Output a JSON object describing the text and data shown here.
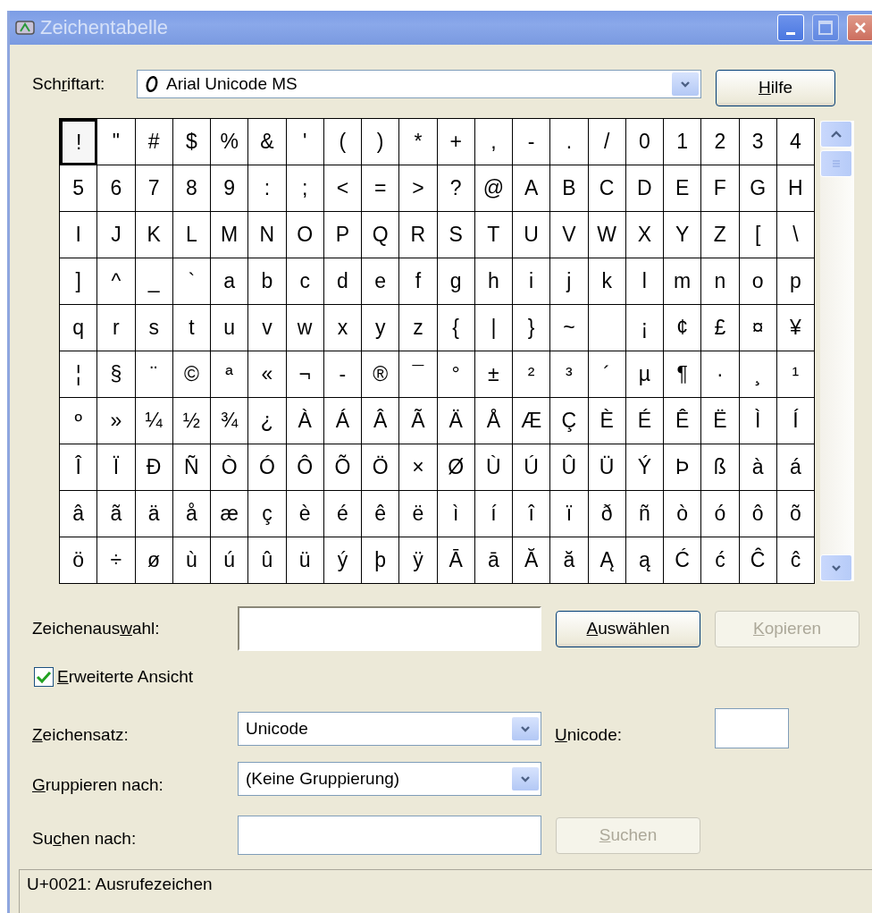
{
  "window": {
    "title": "Zeichentabelle",
    "active": false
  },
  "font": {
    "label": {
      "before": "Sch",
      "key": "r",
      "after": "iftart:"
    },
    "value": "Arial Unicode MS"
  },
  "help_button": {
    "label": {
      "key": "H",
      "after": "ilfe"
    }
  },
  "grid": {
    "rows": [
      {
        "cells": [
          {
            "char": "!",
            "selected": true
          },
          {
            "char": "\"",
            "selected": false
          },
          {
            "char": "#",
            "selected": false
          },
          {
            "char": "$",
            "selected": false
          },
          {
            "char": "%",
            "selected": false
          },
          {
            "char": "&",
            "selected": false
          },
          {
            "char": "'",
            "selected": false
          },
          {
            "char": "(",
            "selected": false
          },
          {
            "char": ")",
            "selected": false
          },
          {
            "char": "*",
            "selected": false
          },
          {
            "char": "+",
            "selected": false
          },
          {
            "char": ",",
            "selected": false
          },
          {
            "char": "-",
            "selected": false
          },
          {
            "char": ".",
            "selected": false
          },
          {
            "char": "/",
            "selected": false
          },
          {
            "char": "0",
            "selected": false
          },
          {
            "char": "1",
            "selected": false
          },
          {
            "char": "2",
            "selected": false
          },
          {
            "char": "3",
            "selected": false
          },
          {
            "char": "4",
            "selected": false
          }
        ]
      },
      {
        "cells": [
          {
            "char": "5",
            "selected": false
          },
          {
            "char": "6",
            "selected": false
          },
          {
            "char": "7",
            "selected": false
          },
          {
            "char": "8",
            "selected": false
          },
          {
            "char": "9",
            "selected": false
          },
          {
            "char": ":",
            "selected": false
          },
          {
            "char": ";",
            "selected": false
          },
          {
            "char": "<",
            "selected": false
          },
          {
            "char": "=",
            "selected": false
          },
          {
            "char": ">",
            "selected": false
          },
          {
            "char": "?",
            "selected": false
          },
          {
            "char": "@",
            "selected": false
          },
          {
            "char": "A",
            "selected": false
          },
          {
            "char": "B",
            "selected": false
          },
          {
            "char": "C",
            "selected": false
          },
          {
            "char": "D",
            "selected": false
          },
          {
            "char": "E",
            "selected": false
          },
          {
            "char": "F",
            "selected": false
          },
          {
            "char": "G",
            "selected": false
          },
          {
            "char": "H",
            "selected": false
          }
        ]
      },
      {
        "cells": [
          {
            "char": "I",
            "selected": false
          },
          {
            "char": "J",
            "selected": false
          },
          {
            "char": "K",
            "selected": false
          },
          {
            "char": "L",
            "selected": false
          },
          {
            "char": "M",
            "selected": false
          },
          {
            "char": "N",
            "selected": false
          },
          {
            "char": "O",
            "selected": false
          },
          {
            "char": "P",
            "selected": false
          },
          {
            "char": "Q",
            "selected": false
          },
          {
            "char": "R",
            "selected": false
          },
          {
            "char": "S",
            "selected": false
          },
          {
            "char": "T",
            "selected": false
          },
          {
            "char": "U",
            "selected": false
          },
          {
            "char": "V",
            "selected": false
          },
          {
            "char": "W",
            "selected": false
          },
          {
            "char": "X",
            "selected": false
          },
          {
            "char": "Y",
            "selected": false
          },
          {
            "char": "Z",
            "selected": false
          },
          {
            "char": "[",
            "selected": false
          },
          {
            "char": "\\",
            "selected": false
          }
        ]
      },
      {
        "cells": [
          {
            "char": "]",
            "selected": false
          },
          {
            "char": "^",
            "selected": false
          },
          {
            "char": "_",
            "selected": false
          },
          {
            "char": "`",
            "selected": false
          },
          {
            "char": "a",
            "selected": false
          },
          {
            "char": "b",
            "selected": false
          },
          {
            "char": "c",
            "selected": false
          },
          {
            "char": "d",
            "selected": false
          },
          {
            "char": "e",
            "selected": false
          },
          {
            "char": "f",
            "selected": false
          },
          {
            "char": "g",
            "selected": false
          },
          {
            "char": "h",
            "selected": false
          },
          {
            "char": "i",
            "selected": false
          },
          {
            "char": "j",
            "selected": false
          },
          {
            "char": "k",
            "selected": false
          },
          {
            "char": "l",
            "selected": false
          },
          {
            "char": "m",
            "selected": false
          },
          {
            "char": "n",
            "selected": false
          },
          {
            "char": "o",
            "selected": false
          },
          {
            "char": "p",
            "selected": false
          }
        ]
      },
      {
        "cells": [
          {
            "char": "q",
            "selected": false
          },
          {
            "char": "r",
            "selected": false
          },
          {
            "char": "s",
            "selected": false
          },
          {
            "char": "t",
            "selected": false
          },
          {
            "char": "u",
            "selected": false
          },
          {
            "char": "v",
            "selected": false
          },
          {
            "char": "w",
            "selected": false
          },
          {
            "char": "x",
            "selected": false
          },
          {
            "char": "y",
            "selected": false
          },
          {
            "char": "z",
            "selected": false
          },
          {
            "char": "{",
            "selected": false
          },
          {
            "char": "|",
            "selected": false
          },
          {
            "char": "}",
            "selected": false
          },
          {
            "char": "~",
            "selected": false
          },
          {
            "selected": false
          },
          {
            "char": "¡",
            "selected": false
          },
          {
            "char": "¢",
            "selected": false
          },
          {
            "char": "£",
            "selected": false
          },
          {
            "char": "¤",
            "selected": false
          },
          {
            "char": "¥",
            "selected": false
          }
        ]
      },
      {
        "cells": [
          {
            "char": "¦",
            "selected": false
          },
          {
            "char": "§",
            "selected": false
          },
          {
            "char": "¨",
            "selected": false
          },
          {
            "char": "©",
            "selected": false
          },
          {
            "char": "ª",
            "selected": false
          },
          {
            "char": "«",
            "selected": false
          },
          {
            "char": "¬",
            "selected": false
          },
          {
            "char": "-",
            "selected": false
          },
          {
            "char": "®",
            "selected": false
          },
          {
            "char": "¯",
            "selected": false
          },
          {
            "char": "°",
            "selected": false
          },
          {
            "char": "±",
            "selected": false
          },
          {
            "char": "²",
            "selected": false
          },
          {
            "char": "³",
            "selected": false
          },
          {
            "char": "´",
            "selected": false
          },
          {
            "char": "µ",
            "selected": false
          },
          {
            "char": "¶",
            "selected": false
          },
          {
            "char": "·",
            "selected": false
          },
          {
            "char": "¸",
            "selected": false
          },
          {
            "char": "¹",
            "selected": false
          }
        ]
      },
      {
        "cells": [
          {
            "char": "º",
            "selected": false
          },
          {
            "char": "»",
            "selected": false
          },
          {
            "char": "¼",
            "selected": false
          },
          {
            "char": "½",
            "selected": false
          },
          {
            "char": "¾",
            "selected": false
          },
          {
            "char": "¿",
            "selected": false
          },
          {
            "char": "À",
            "selected": false
          },
          {
            "char": "Á",
            "selected": false
          },
          {
            "char": "Â",
            "selected": false
          },
          {
            "char": "Ã",
            "selected": false
          },
          {
            "char": "Ä",
            "selected": false
          },
          {
            "char": "Å",
            "selected": false
          },
          {
            "char": "Æ",
            "selected": false
          },
          {
            "char": "Ç",
            "selected": false
          },
          {
            "char": "È",
            "selected": false
          },
          {
            "char": "É",
            "selected": false
          },
          {
            "char": "Ê",
            "selected": false
          },
          {
            "char": "Ë",
            "selected": false
          },
          {
            "char": "Ì",
            "selected": false
          },
          {
            "char": "Í",
            "selected": false
          }
        ]
      },
      {
        "cells": [
          {
            "char": "Î",
            "selected": false
          },
          {
            "char": "Ï",
            "selected": false
          },
          {
            "char": "Ð",
            "selected": false
          },
          {
            "char": "Ñ",
            "selected": false
          },
          {
            "char": "Ò",
            "selected": false
          },
          {
            "char": "Ó",
            "selected": false
          },
          {
            "char": "Ô",
            "selected": false
          },
          {
            "char": "Õ",
            "selected": false
          },
          {
            "char": "Ö",
            "selected": false
          },
          {
            "char": "×",
            "selected": false
          },
          {
            "char": "Ø",
            "selected": false
          },
          {
            "char": "Ù",
            "selected": false
          },
          {
            "char": "Ú",
            "selected": false
          },
          {
            "char": "Û",
            "selected": false
          },
          {
            "char": "Ü",
            "selected": false
          },
          {
            "char": "Ý",
            "selected": false
          },
          {
            "char": "Þ",
            "selected": false
          },
          {
            "char": "ß",
            "selected": false
          },
          {
            "char": "à",
            "selected": false
          },
          {
            "char": "á",
            "selected": false
          }
        ]
      },
      {
        "cells": [
          {
            "char": "â",
            "selected": false
          },
          {
            "char": "ã",
            "selected": false
          },
          {
            "char": "ä",
            "selected": false
          },
          {
            "char": "å",
            "selected": false
          },
          {
            "char": "æ",
            "selected": false
          },
          {
            "char": "ç",
            "selected": false
          },
          {
            "char": "è",
            "selected": false
          },
          {
            "char": "é",
            "selected": false
          },
          {
            "char": "ê",
            "selected": false
          },
          {
            "char": "ë",
            "selected": false
          },
          {
            "char": "ì",
            "selected": false
          },
          {
            "char": "í",
            "selected": false
          },
          {
            "char": "î",
            "selected": false
          },
          {
            "char": "ï",
            "selected": false
          },
          {
            "char": "ð",
            "selected": false
          },
          {
            "char": "ñ",
            "selected": false
          },
          {
            "char": "ò",
            "selected": false
          },
          {
            "char": "ó",
            "selected": false
          },
          {
            "char": "ô",
            "selected": false
          },
          {
            "char": "õ",
            "selected": false
          }
        ]
      },
      {
        "cells": [
          {
            "char": "ö",
            "selected": false
          },
          {
            "char": "÷",
            "selected": false
          },
          {
            "char": "ø",
            "selected": false
          },
          {
            "char": "ù",
            "selected": false
          },
          {
            "char": "ú",
            "selected": false
          },
          {
            "char": "û",
            "selected": false
          },
          {
            "char": "ü",
            "selected": false
          },
          {
            "char": "ý",
            "selected": false
          },
          {
            "char": "þ",
            "selected": false
          },
          {
            "char": "ÿ",
            "selected": false
          },
          {
            "char": "Ā",
            "selected": false
          },
          {
            "char": "ā",
            "selected": false
          },
          {
            "char": "Ă",
            "selected": false
          },
          {
            "char": "ă",
            "selected": false
          },
          {
            "char": "Ą",
            "selected": false
          },
          {
            "char": "ą",
            "selected": false
          },
          {
            "char": "Ć",
            "selected": false
          },
          {
            "char": "ć",
            "selected": false
          },
          {
            "char": "Ĉ",
            "selected": false
          },
          {
            "char": "ĉ",
            "selected": false
          }
        ]
      }
    ]
  },
  "selection": {
    "label": {
      "before": "Zeichenaus",
      "key": "w",
      "after": "ahl:"
    },
    "select_button": {
      "label": {
        "key": "A",
        "after": "uswählen"
      },
      "disabled": false
    },
    "copy_button": {
      "label": {
        "key": "K",
        "after": "opieren"
      },
      "disabled": true
    }
  },
  "advanced_view": {
    "label": {
      "key": "E",
      "after": "rweiterte Ansicht"
    },
    "checked": true
  },
  "charset": {
    "label": {
      "key": "Z",
      "after": "eichensatz:"
    },
    "value": "Unicode"
  },
  "unicode": {
    "label": {
      "key": "U",
      "after": "nicode:"
    }
  },
  "group_by": {
    "label": {
      "key": "G",
      "after": "ruppieren nach:"
    },
    "value": "(Keine Gruppierung)"
  },
  "search": {
    "label": {
      "before": "Su",
      "key": "c",
      "after": "hen nach:"
    },
    "button": {
      "label": {
        "key": "S",
        "after": "uchen"
      },
      "disabled": true
    }
  },
  "status_bar": "U+0021: Ausrufezeichen"
}
